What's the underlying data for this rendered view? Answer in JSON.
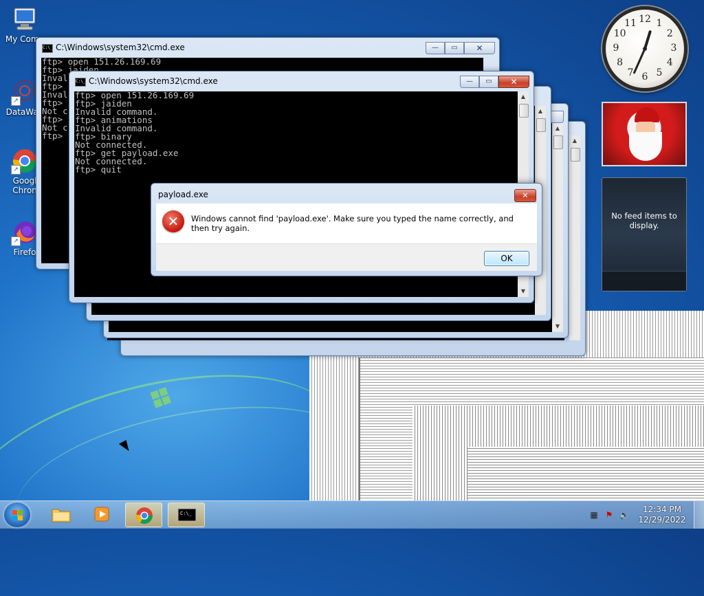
{
  "desktop": {
    "icons": [
      {
        "label": "My Comp",
        "icon": "computer-icon"
      },
      {
        "label": "DataWag",
        "icon": "datawag-icon"
      },
      {
        "label": "Googl",
        "label2": "Chron",
        "icon": "chrome-icon"
      },
      {
        "label": "Firefo",
        "icon": "firefox-icon"
      }
    ]
  },
  "cmd_back": {
    "title": "C:\\Windows\\system32\\cmd.exe",
    "lines": [
      "ftp> open 151.26.169.69",
      "ftp> jaiden",
      "Inval",
      "ftp>",
      "Inval",
      "ftp>",
      "Not c",
      "ftp>",
      "Not c",
      "ftp>"
    ]
  },
  "cmd_front": {
    "title": "C:\\Windows\\system32\\cmd.exe",
    "lines": [
      "ftp> open 151.26.169.69",
      "ftp> jaiden",
      "Invalid command.",
      "ftp> animations",
      "Invalid command.",
      "ftp> binary",
      "Not connected.",
      "ftp> get payload.exe",
      "Not connected.",
      "ftp> quit"
    ]
  },
  "dialog": {
    "title": "payload.exe",
    "message": "Windows cannot find 'payload.exe'. Make sure you typed the name correctly, and then try again.",
    "ok_label": "OK",
    "close_label": "✕"
  },
  "window_buttons": {
    "minimize": "—",
    "maximize": "▭",
    "close": "✕"
  },
  "gadgets": {
    "clock_numbers": [
      "12",
      "1",
      "2",
      "3",
      "4",
      "5",
      "6",
      "7",
      "8",
      "9",
      "10",
      "11"
    ],
    "clock_time": "12:34",
    "feed_text": "No feed items to display."
  },
  "taskbar": {
    "buttons": [
      {
        "name": "explorer",
        "icon": "folder-icon"
      },
      {
        "name": "media-player",
        "icon": "media-player-icon"
      },
      {
        "name": "chrome",
        "icon": "chrome-icon"
      },
      {
        "name": "cmd",
        "icon": "cmd-icon"
      }
    ],
    "time": "12:34 PM",
    "date": "12/29/2022"
  },
  "colors": {
    "accent": "#1f73c9",
    "console_bg": "#000000",
    "console_fg": "#c0c0c0",
    "error_red": "#c4180c"
  }
}
